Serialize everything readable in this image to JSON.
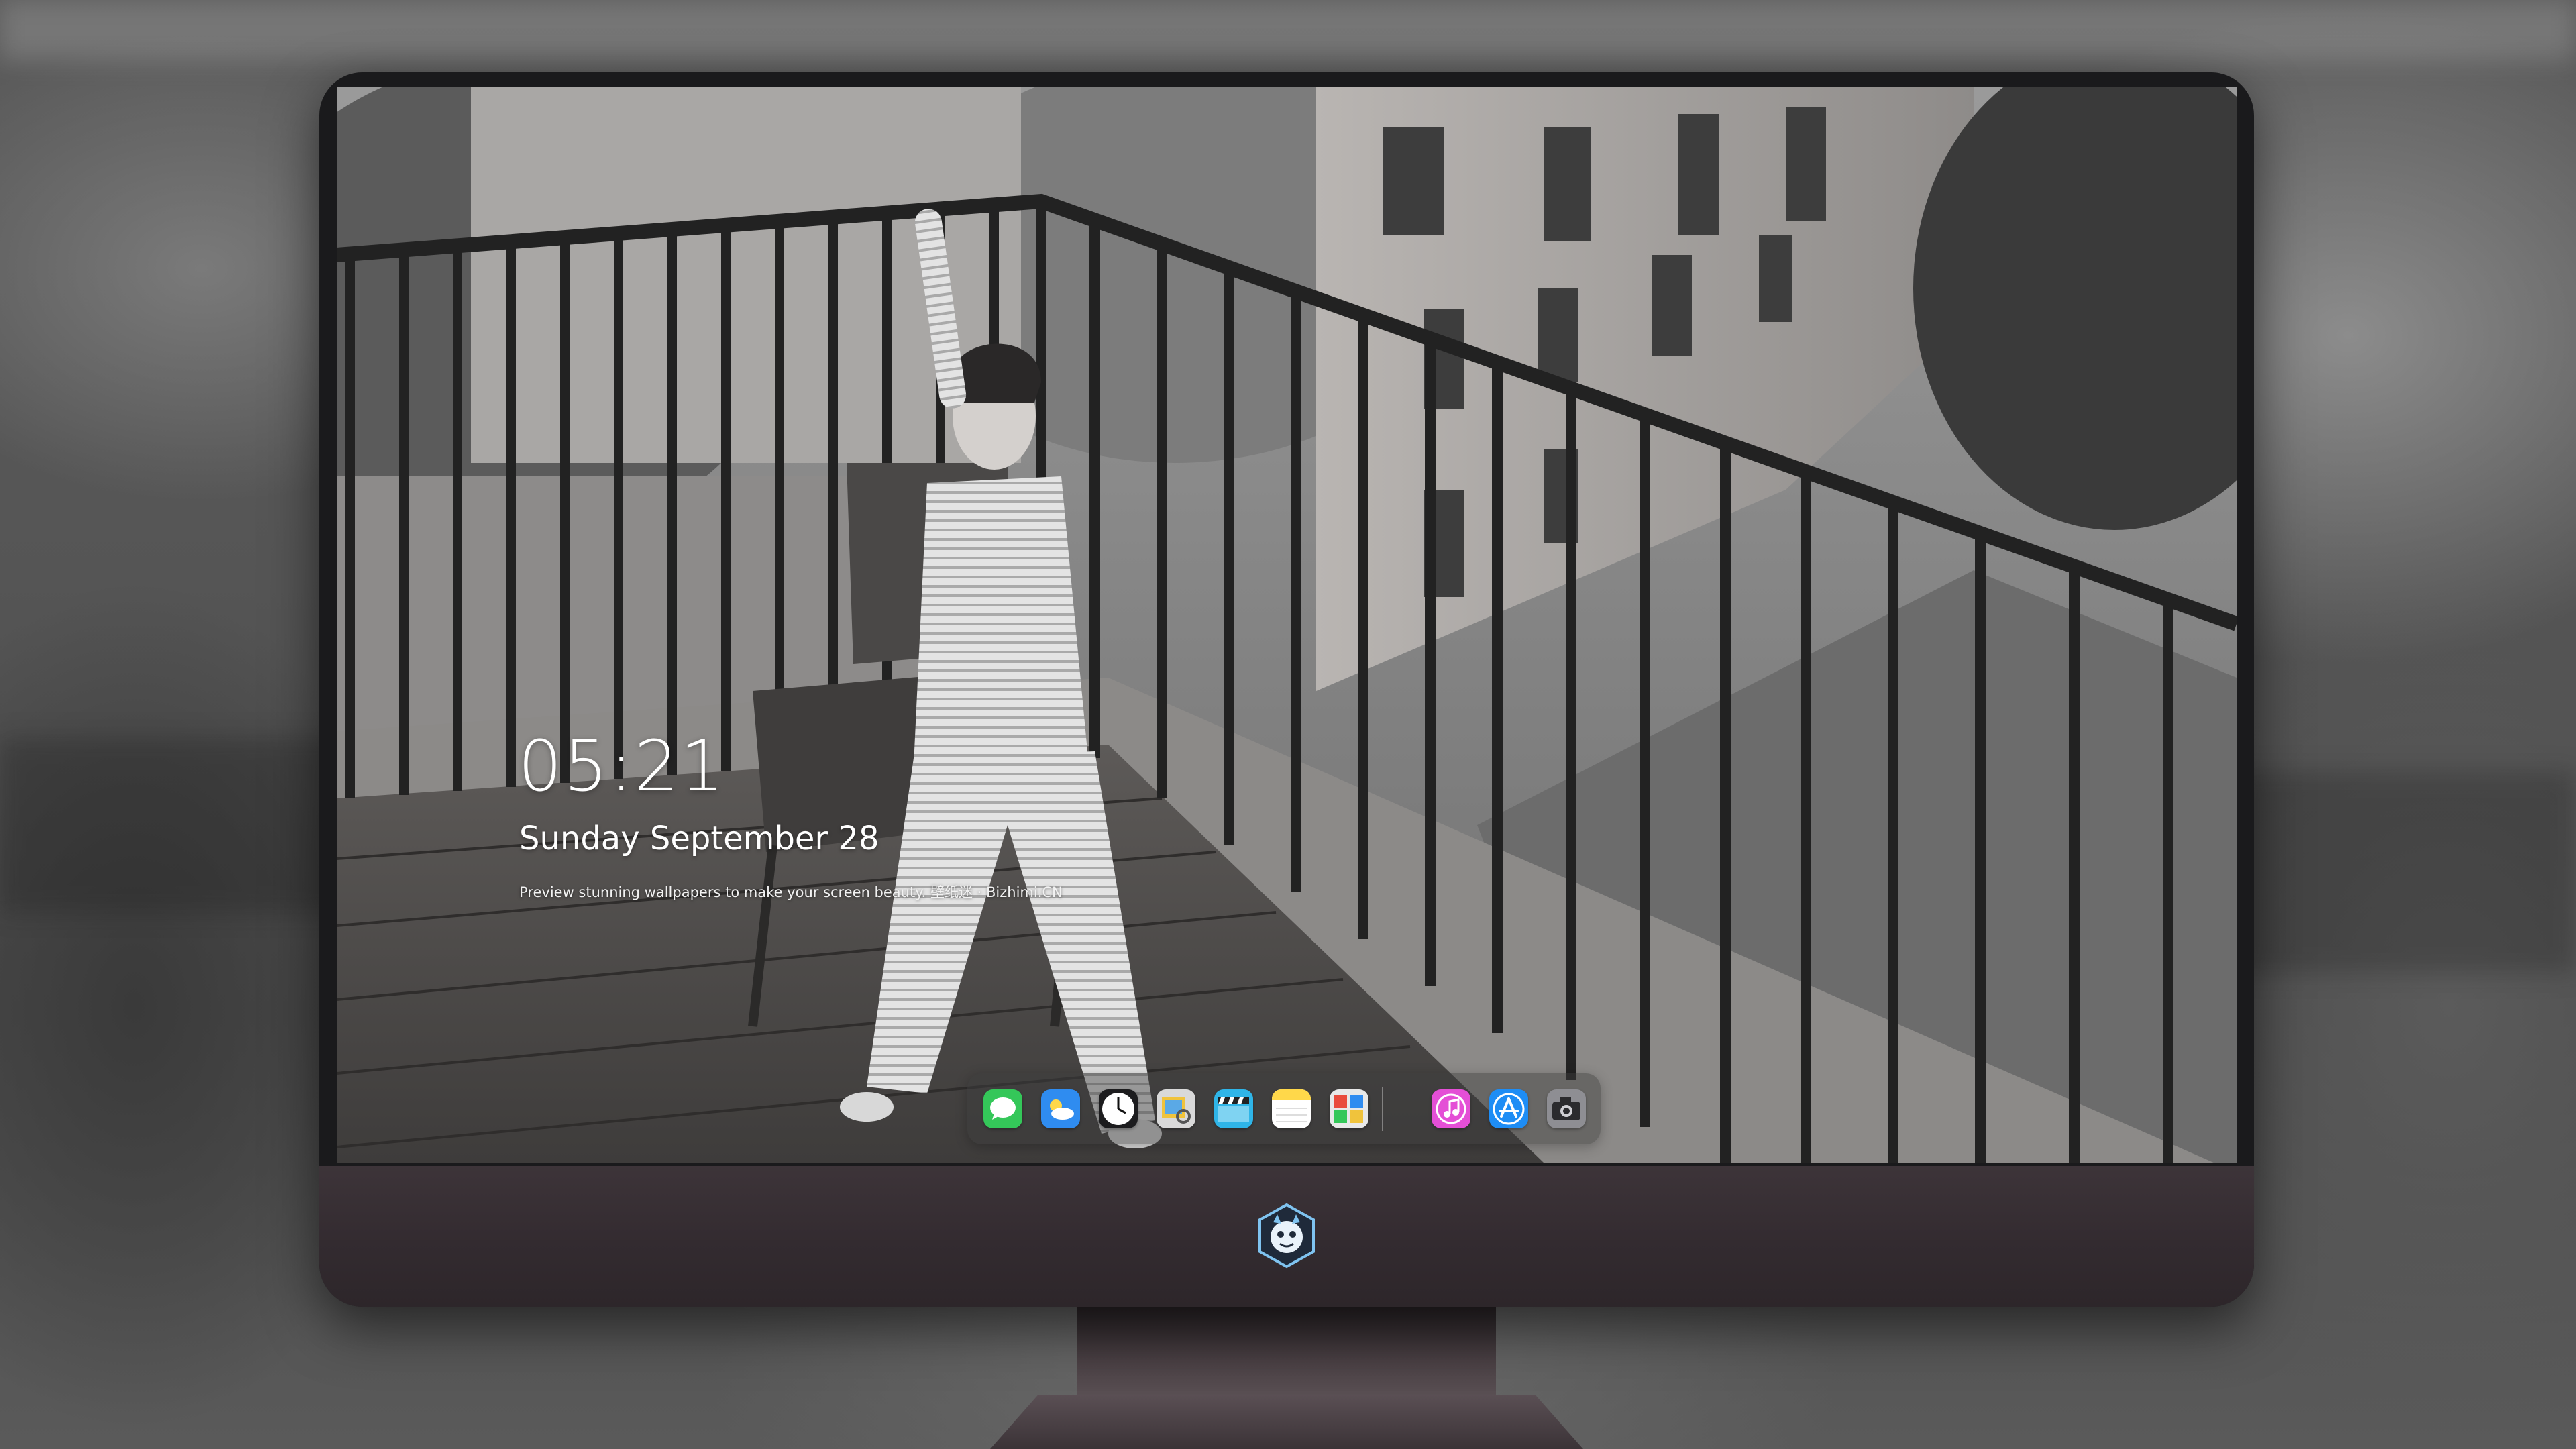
{
  "lock_screen": {
    "time": "05:21",
    "date": "Sunday September 28",
    "tagline": "Preview stunning wallpapers to make your screen beauty. 壁纸迷 · Bizhimi.CN"
  },
  "dock": {
    "apps": [
      {
        "name": "messages-icon",
        "color": "#34c759"
      },
      {
        "name": "weather-icon",
        "color": "#2f8cf0"
      },
      {
        "name": "clock-icon",
        "color": "#ffffff"
      },
      {
        "name": "preview-icon",
        "color": "#f0c33c"
      },
      {
        "name": "clips-icon",
        "color": "#2fb5e8"
      },
      {
        "name": "notes-icon",
        "color": "#ffd84a"
      },
      {
        "name": "photo-booth-icon",
        "color": "#e8e8e8"
      },
      {
        "name": "itunes-icon",
        "color": "#e44fd6"
      },
      {
        "name": "app-store-icon",
        "color": "#1e8df5"
      },
      {
        "name": "camera-icon",
        "color": "#8e8e93"
      }
    ]
  },
  "monitor": {
    "frame_color": "#1a1a1c",
    "chin_color": "#3d3439",
    "logo": "bizhimi-mascot-logo"
  }
}
